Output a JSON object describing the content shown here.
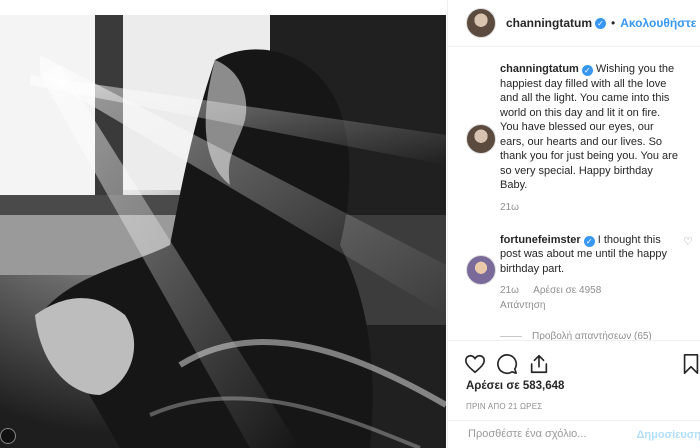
{
  "post": {
    "username": "channingtatum",
    "follow_label": "Ακολουθήστε",
    "dot": "•"
  },
  "caption": {
    "username": "channingtatum",
    "text": "Wishing you the happiest day filled with all the love and all the light. You came into this world on this day and lit it on fire. You have blessed our eyes, our ears, our hearts and our lives. So thank you for just being you. You are so very special. Happy birthday Baby.",
    "time": "21ω"
  },
  "comments": [
    {
      "username": "fortunefeimster",
      "text": "I thought this post was about me until the happy birthday part.",
      "time": "21ω",
      "likes": "Αρέσει σε 4958",
      "reply": "Απάντηση",
      "view_replies": "Προβολή απαντήσεων (65)"
    }
  ],
  "actions": {
    "like_icon": "heart-outline-icon",
    "comment_icon": "speech-bubble-icon",
    "share_icon": "share-icon",
    "save_icon": "bookmark-icon"
  },
  "likes_text": "Αρέσει σε 583,648",
  "timestamp": "ΠΡΙΝ ΑΠΟ 21 ΩΡΕΣ",
  "add_comment": {
    "placeholder": "Προσθέστε ένα σχόλιο...",
    "post_label": "Δημοσίευση"
  },
  "colors": {
    "link_blue": "#3897f0",
    "muted_text": "#8e8e8e",
    "post_disabled": "#b2dffc"
  }
}
